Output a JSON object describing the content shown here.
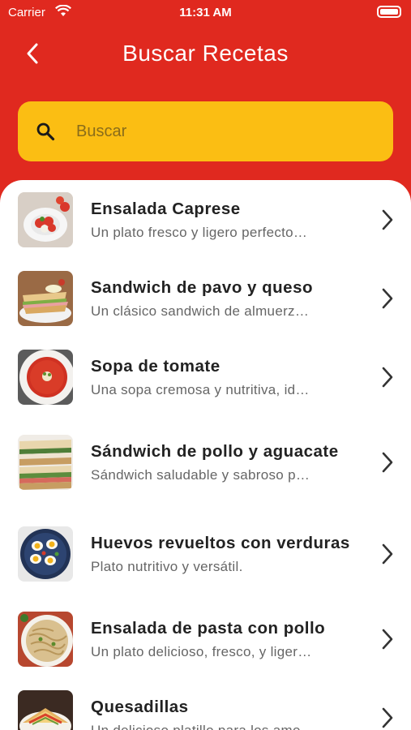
{
  "status_bar": {
    "carrier": "Carrier",
    "time": "11:31 AM"
  },
  "header": {
    "title": "Buscar Recetas"
  },
  "search": {
    "placeholder": "Buscar",
    "value": ""
  },
  "recipes": [
    {
      "title": "Ensalada Caprese",
      "description": "Un plato fresco y ligero perfecto…"
    },
    {
      "title": "Sandwich de pavo y queso",
      "description": "Un clásico sandwich de almuerz…"
    },
    {
      "title": "Sopa de tomate",
      "description": "Una sopa cremosa y nutritiva, id…"
    },
    {
      "title": "Sándwich de pollo y aguacate",
      "description": "Sándwich saludable y sabroso p…"
    },
    {
      "title": "Huevos revueltos con verduras",
      "description": "Plato nutritivo y versátil."
    },
    {
      "title": "Ensalada de pasta con pollo",
      "description": "Un plato delicioso, fresco, y liger…"
    },
    {
      "title": "Quesadillas",
      "description": "Un delicioso platillo para los amo…"
    }
  ],
  "colors": {
    "header_bg": "#e0291f",
    "search_bg": "#fbbe13",
    "list_bg": "#ffffff"
  }
}
